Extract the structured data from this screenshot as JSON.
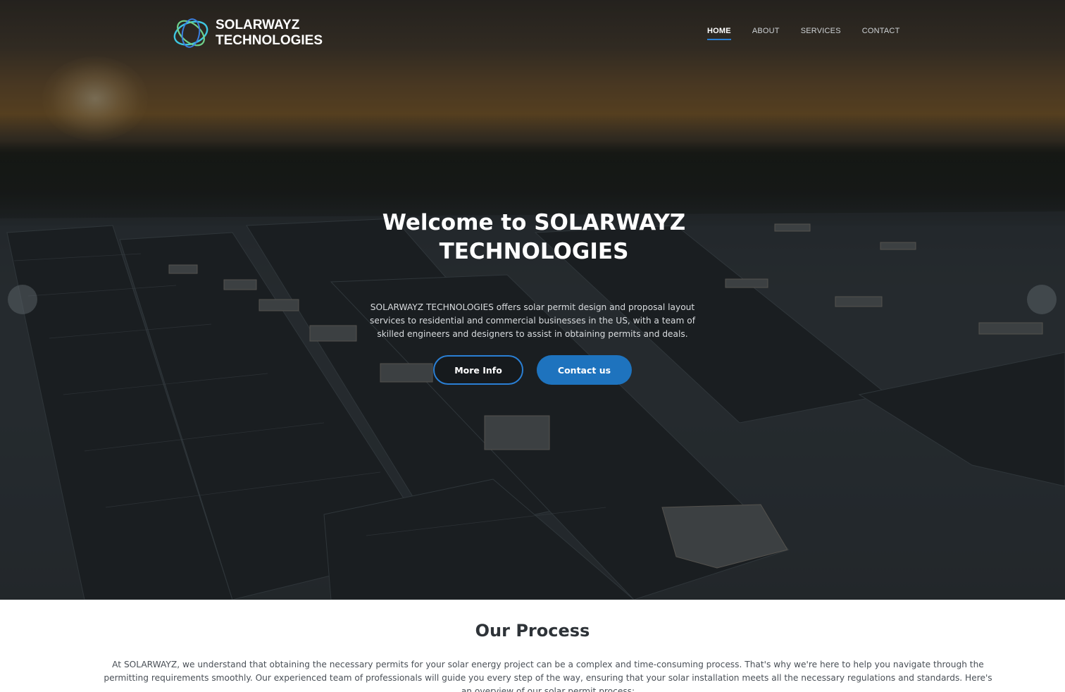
{
  "brand": {
    "name_line1": "SOLARWAYZ",
    "name_line2": "TECHNOLOGIES",
    "logo_icon": "orbit-rings-logo"
  },
  "nav": {
    "items": [
      {
        "label": "HOME",
        "active": true
      },
      {
        "label": "ABOUT",
        "active": false
      },
      {
        "label": "SERVICES",
        "active": false
      },
      {
        "label": "CONTACT",
        "active": false
      }
    ]
  },
  "hero": {
    "title": "Welcome to SOLARWAYZ TECHNOLOGIES",
    "text": "SOLARWAYZ TECHNOLOGIES offers solar permit design and proposal layout services to residential and commercial businesses in the US, with a team of skilled engineers and designers to assist in obtaining permits and deals.",
    "more_info_label": "More Info",
    "contact_label": "Contact us",
    "prev_icon": "chevron-left-icon",
    "next_icon": "chevron-right-icon"
  },
  "process": {
    "title": "Our Process",
    "text": "At SOLARWAYZ, we understand that obtaining the necessary permits for your solar energy project can be a complex and time-consuming process. That's why we're here to help you navigate through the permitting requirements smoothly. Our experienced team of professionals will guide you every step of the way, ensuring that your solar installation meets all the necessary regulations and standards. Here's an overview of our solar permit process:"
  },
  "colors": {
    "accent": "#1e73be",
    "accent_border": "#2a7fd4",
    "heading": "#2e3338",
    "body_text": "#4a5057"
  }
}
